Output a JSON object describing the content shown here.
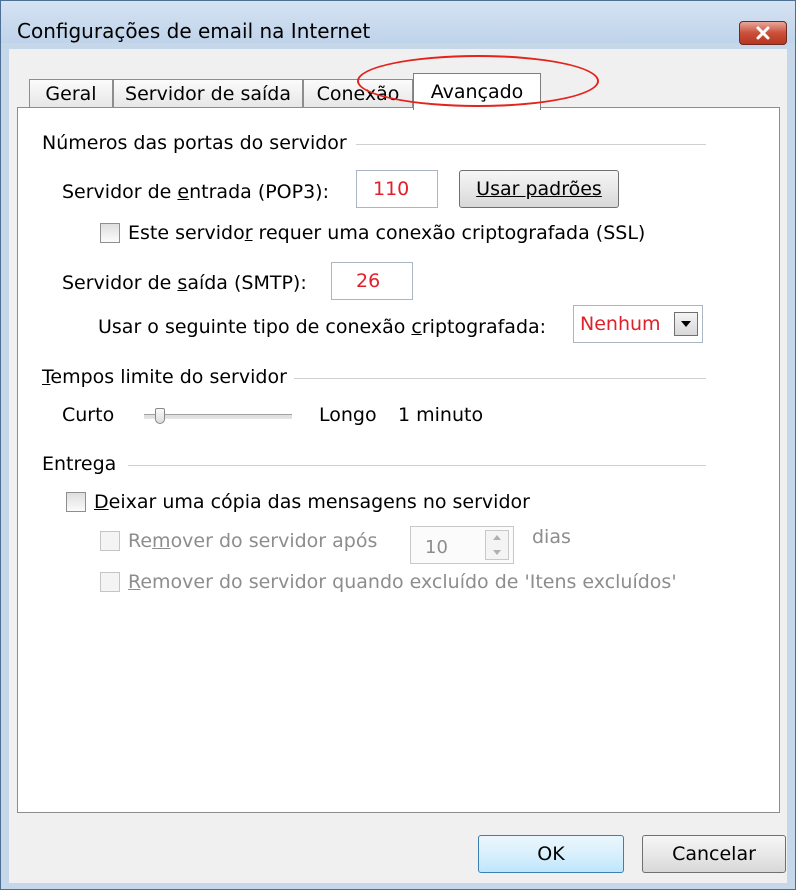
{
  "window": {
    "title": "Configurações de email na Internet"
  },
  "tabs": [
    {
      "label": "Geral"
    },
    {
      "label": "Servidor de saída"
    },
    {
      "label": "Conexão"
    },
    {
      "label": "Avançado",
      "active": true
    }
  ],
  "ports": {
    "group_label": "Números das portas do servidor",
    "incoming_label": "Servidor de entrada (POP3):",
    "incoming_value": "110",
    "use_defaults_label": "Usar padrões",
    "ssl_label": "Este servidor requer uma conexão criptografada (SSL)",
    "ssl_checked": false,
    "outgoing_label": "Servidor de saída (SMTP):",
    "outgoing_value": "26",
    "encryption_label": "Usar o seguinte tipo de conexão criptografada:",
    "encryption_value": "Nenhum"
  },
  "timeouts": {
    "group_label": "Tempos limite do servidor",
    "short_label": "Curto",
    "long_label": "Longo",
    "value_text": "1 minuto",
    "slider_fraction": 0.08
  },
  "delivery": {
    "group_label": "Entrega",
    "leave_copy_label": "Deixar uma cópia das mensagens no servidor",
    "leave_copy_checked": false,
    "remove_after_label": "Remover do servidor após",
    "remove_after_days": "10",
    "days_label": "dias",
    "remove_deleted_label": "Remover do servidor quando excluído de 'Itens excluídos'"
  },
  "footer": {
    "ok_label": "OK",
    "cancel_label": "Cancelar"
  },
  "colors": {
    "accent_red": "#e0202a",
    "annotation": "#e3231c"
  }
}
